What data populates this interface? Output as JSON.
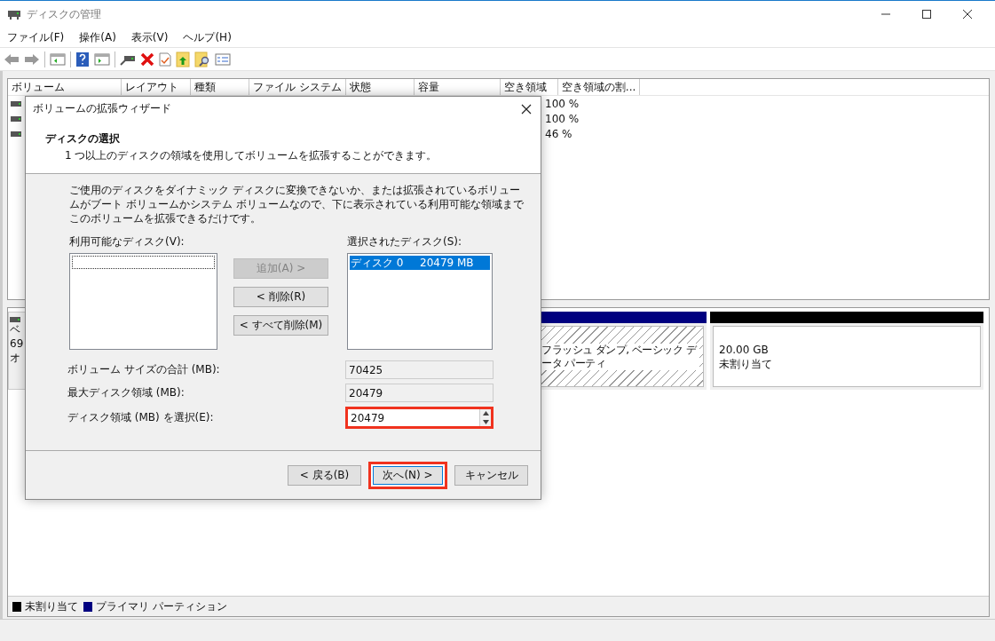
{
  "window": {
    "title": "ディスクの管理"
  },
  "menu": [
    "ファイル(F)",
    "操作(A)",
    "表示(V)",
    "ヘルプ(H)"
  ],
  "volume_table": {
    "columns": [
      "ボリューム",
      "レイアウト",
      "種類",
      "ファイル システム",
      "状態",
      "容量",
      "空き領域",
      "空き領域の割..."
    ],
    "rows": [
      {
        "free_ratio": "100 %"
      },
      {
        "free_ratio": "100 %"
      },
      {
        "free_ratio": "46 %"
      }
    ]
  },
  "disk": {
    "label_lines": [
      "ベ",
      "69",
      "オ"
    ],
    "partitions": [
      {
        "kind": "hatched",
        "color": "#000080",
        "lines": [
          "フラッシュ ダンプ, ベーシック データ パーティ"
        ]
      },
      {
        "kind": "plain",
        "color": "#000000",
        "lines": [
          "20.00 GB",
          "未割り当て"
        ]
      }
    ]
  },
  "legend": [
    {
      "label": "未割り当て",
      "color": "#000000"
    },
    {
      "label": "プライマリ パーティション",
      "color": "#000080"
    }
  ],
  "dialog": {
    "title": "ボリュームの拡張ウィザード",
    "heading": "ディスクの選択",
    "subheading": "1 つ以上のディスクの領域を使用してボリュームを拡張することができます。",
    "description": "ご使用のディスクをダイナミック ディスクに変換できないか、または拡張されているボリュームがブート ボリュームかシステム ボリュームなので、下に表示されている利用可能な領域までこのボリュームを拡張できるだけです。",
    "available": {
      "label": "利用可能なディスク(V):"
    },
    "move_buttons": [
      {
        "label": "追加(A) >",
        "disabled": true
      },
      {
        "label": "< 削除(R)",
        "disabled": false
      },
      {
        "label": "< すべて削除(M)",
        "disabled": false
      }
    ],
    "selected": {
      "label": "選択されたディスク(S):",
      "items": [
        {
          "name": "ディスク 0",
          "size": "20479 MB",
          "selected": true
        }
      ]
    },
    "fields": [
      {
        "kind": "readonly",
        "label": "ボリューム サイズの合計 (MB):",
        "value": "70425",
        "highlighted": false
      },
      {
        "kind": "readonly",
        "label": "最大ディスク領域 (MB):",
        "value": "20479",
        "highlighted": false
      },
      {
        "kind": "spin",
        "label": "ディスク領域 (MB) を選択(E):",
        "value": "20479",
        "highlighted": true
      }
    ],
    "buttons": [
      {
        "label": "< 戻る(B)",
        "highlighted": false
      },
      {
        "label": "次へ(N) >",
        "highlighted": true
      },
      {
        "label": "キャンセル",
        "highlighted": false
      }
    ]
  }
}
